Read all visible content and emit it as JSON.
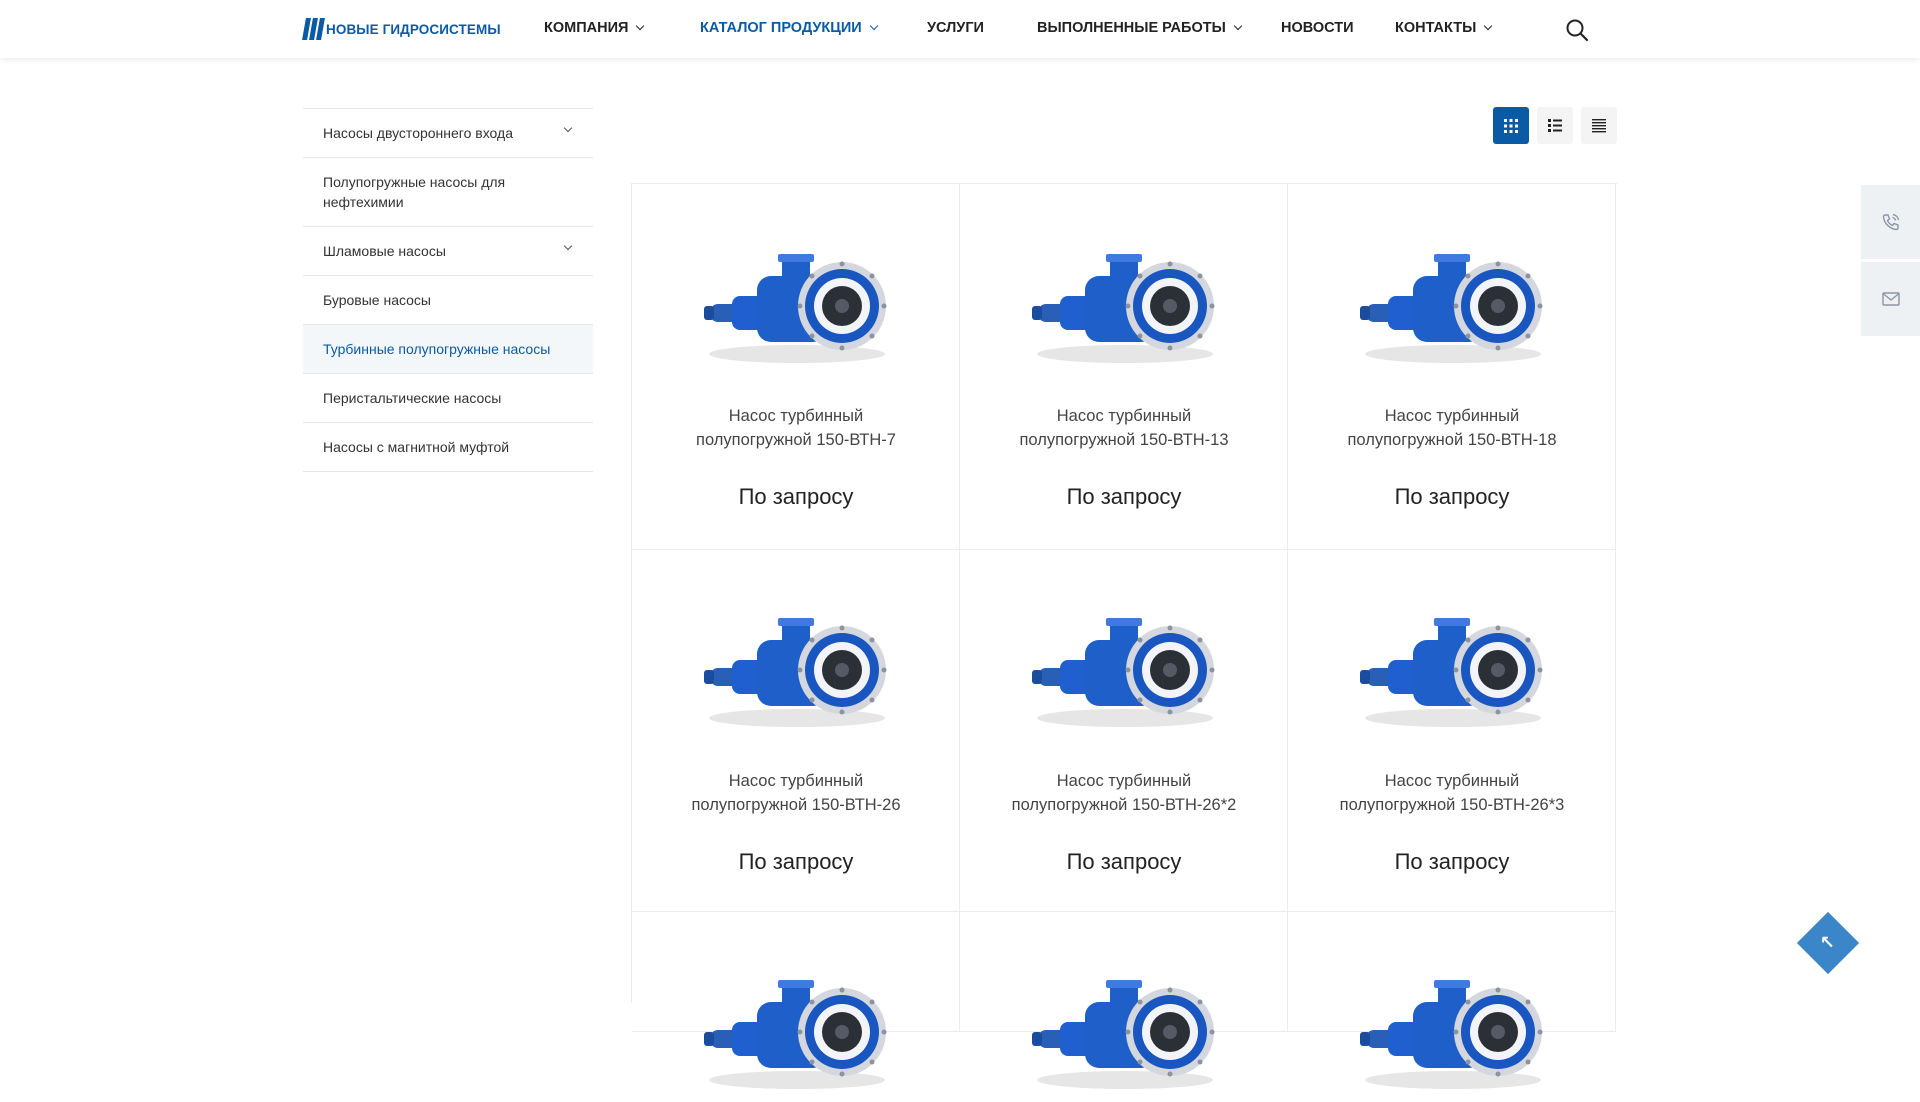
{
  "header": {
    "logo_text": "НОВЫЕ ГИДРОСИСТЕМЫ",
    "nav": [
      {
        "label": "КОМПАНИЯ",
        "has_dropdown": true
      },
      {
        "label": "КАТАЛОГ ПРОДУКЦИИ",
        "has_dropdown": true,
        "active": true
      },
      {
        "label": "УСЛУГИ",
        "has_dropdown": false
      },
      {
        "label": "ВЫПОЛНЕННЫЕ РАБОТЫ",
        "has_dropdown": true
      },
      {
        "label": "НОВОСТИ",
        "has_dropdown": false
      },
      {
        "label": "КОНТАКТЫ",
        "has_dropdown": true
      }
    ],
    "search_icon": "search-icon"
  },
  "sidebar": {
    "items": [
      {
        "label": "Насосы двустороннего входа",
        "has_children": true
      },
      {
        "label": "Полупогружные насосы для нефтехимии",
        "has_children": false
      },
      {
        "label": "Шламовые насосы",
        "has_children": true
      },
      {
        "label": "Буровые насосы",
        "has_children": false
      },
      {
        "label": "Турбинные полупогружные насосы",
        "has_children": false,
        "active": true
      },
      {
        "label": "Перистальтические насосы",
        "has_children": false
      },
      {
        "label": "Насосы с магнитной муфтой",
        "has_children": false
      }
    ]
  },
  "view_toggle": {
    "options": [
      "grid-view-icon",
      "list-view-icon",
      "table-view-icon"
    ],
    "active": "grid-view-icon"
  },
  "products": [
    {
      "name_line1": "Насос турбинный",
      "name_line2": "полупогружной 150-ВТН-7",
      "price": "По запросу"
    },
    {
      "name_line1": "Насос турбинный",
      "name_line2": "полупогружной 150-ВТН-13",
      "price": "По запросу"
    },
    {
      "name_line1": "Насос турбинный",
      "name_line2": "полупогружной 150-ВТН-18",
      "price": "По запросу"
    },
    {
      "name_line1": "Насос турбинный",
      "name_line2": "полупогружной 150-ВТН-26",
      "price": "По запросу"
    },
    {
      "name_line1": "Насос турбинный",
      "name_line2": "полупогружной 150-ВТН-26*2",
      "price": "По запросу"
    },
    {
      "name_line1": "Насос турбинный",
      "name_line2": "полупогружной 150-ВТН-26*3",
      "price": "По запросу"
    }
  ],
  "floating_actions": [
    "phone-callback-icon",
    "mail-icon"
  ],
  "scroll_top_icon": "arrow-up-left-icon",
  "colors": {
    "brand": "#0a5aa6",
    "pump_blue": "#1e5fc9",
    "panel_bg": "#eef1f4"
  }
}
